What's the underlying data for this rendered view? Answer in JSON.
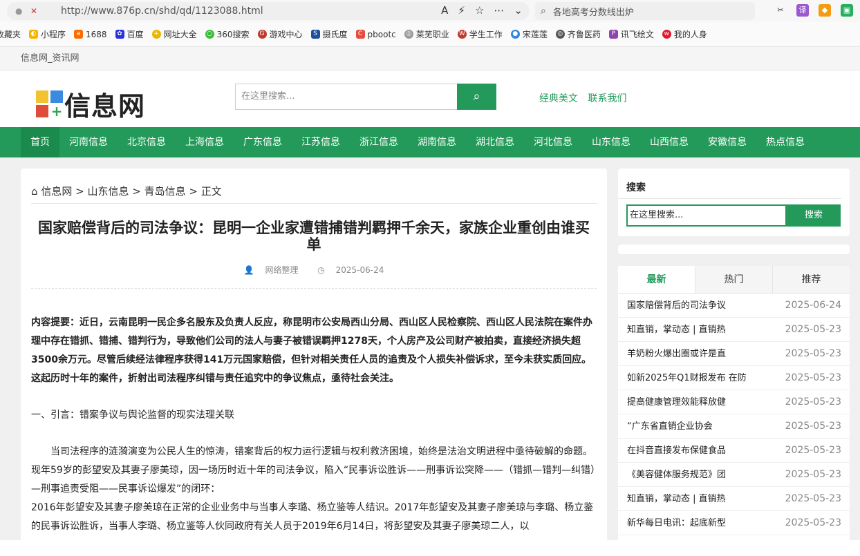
{
  "browser": {
    "url": "http://www.876p.cn/shd/qd/1123088.html",
    "search_placeholder": "各地高考分数线出炉",
    "bookmarks": [
      "收藏夹",
      "小程序",
      "1688",
      "百度",
      "网址大全",
      "360搜索",
      "游戏中心",
      "摄氏度",
      "pbootc",
      "莱芜职业",
      "学生工作",
      "宋莲莲",
      "齐鲁医药",
      "讯飞绘文",
      "我的人身"
    ]
  },
  "site": {
    "top_strip": "信息网_资讯网",
    "logo_text": "信息网",
    "search_placeholder": "在这里搜索...",
    "links": [
      "经典美文",
      "联系我们"
    ],
    "nav": [
      "首页",
      "河南信息",
      "北京信息",
      "上海信息",
      "广东信息",
      "江苏信息",
      "浙江信息",
      "湖南信息",
      "湖北信息",
      "河北信息",
      "山东信息",
      "山西信息",
      "安徽信息",
      "热点信息"
    ]
  },
  "article": {
    "breadcrumb": [
      "信息网",
      "山东信息",
      "青岛信息",
      "正文"
    ],
    "title": "国家赔偿背后的司法争议：昆明一企业家遭错捕错判羁押千余天，家族企业重创由谁买单",
    "author": "网络整理",
    "date": "2025-06-24",
    "lead": "内容提要：近日，云南昆明一民企多名股东及负责人反应，称昆明市公安局西山分局、西山区人民检察院、西山区人民法院在案件办理中存在错抓、错捕、错判行为，导致他们公司的法人与妻子被错误羁押1278天，个人房产及公司财产被拍卖，直接经济损失超3500余万元。尽管后续经法律程序获得141万元国家赔偿，但针对相关责任人员的追责及个人损失补偿诉求，至今未获实质回应。这起历时十年的案件，折射出司法程序纠错与责任追究中的争议焦点，亟待社会关注。",
    "section1": "一、引言：错案争议与舆论监督的现实法理关联",
    "para1": "当司法程序的涟漪演变为公民人生的惊涛，错案背后的权力运行逻辑与权利救济困境，始终是法治文明进程中亟待破解的命题。现年59岁的彭望安及其妻子廖美琼，因一场历时近十年的司法争议，陷入“民事诉讼胜诉——刑事诉讼突降——（错抓—错判—纠错）—刑事追责受阻——民事诉讼爆发”的闭环：",
    "para2": "2016年彭望安及其妻子廖美琼在正常的企业业务中与当事人李璐、杨立鉴等人结识。2017年彭望安及其妻子廖美琼与李璐、杨立鉴的民事诉讼胜诉，当事人李璐、杨立鉴等人伙同政府有关人员于2019年6月14日，将彭望安及其妻子廖美琼二人，以"
  },
  "sidebar": {
    "search_title": "搜索",
    "search_placeholder": "在这里搜索...",
    "search_button": "搜索",
    "tabs": [
      "最新",
      "热门",
      "推荐"
    ],
    "items": [
      {
        "title": "国家赔偿背后的司法争议",
        "date": "2025-06-24"
      },
      {
        "title": "知直销，掌动态 | 直销热",
        "date": "2025-05-23"
      },
      {
        "title": "羊奶粉火爆出圈或许是直",
        "date": "2025-05-23"
      },
      {
        "title": "如新2025年Q1财报发布 在防",
        "date": "2025-05-23"
      },
      {
        "title": "提高健康管理效能释放健",
        "date": "2025-05-23"
      },
      {
        "title": "“广东省直销企业协会",
        "date": "2025-05-23"
      },
      {
        "title": "在抖音直接发布保健食品",
        "date": "2025-05-23"
      },
      {
        "title": "《美容健体服务规范》团",
        "date": "2025-05-23"
      },
      {
        "title": "知直销，掌动态 | 直销热",
        "date": "2025-05-23"
      },
      {
        "title": "新华每日电讯：起底新型",
        "date": "2025-05-23"
      }
    ]
  }
}
